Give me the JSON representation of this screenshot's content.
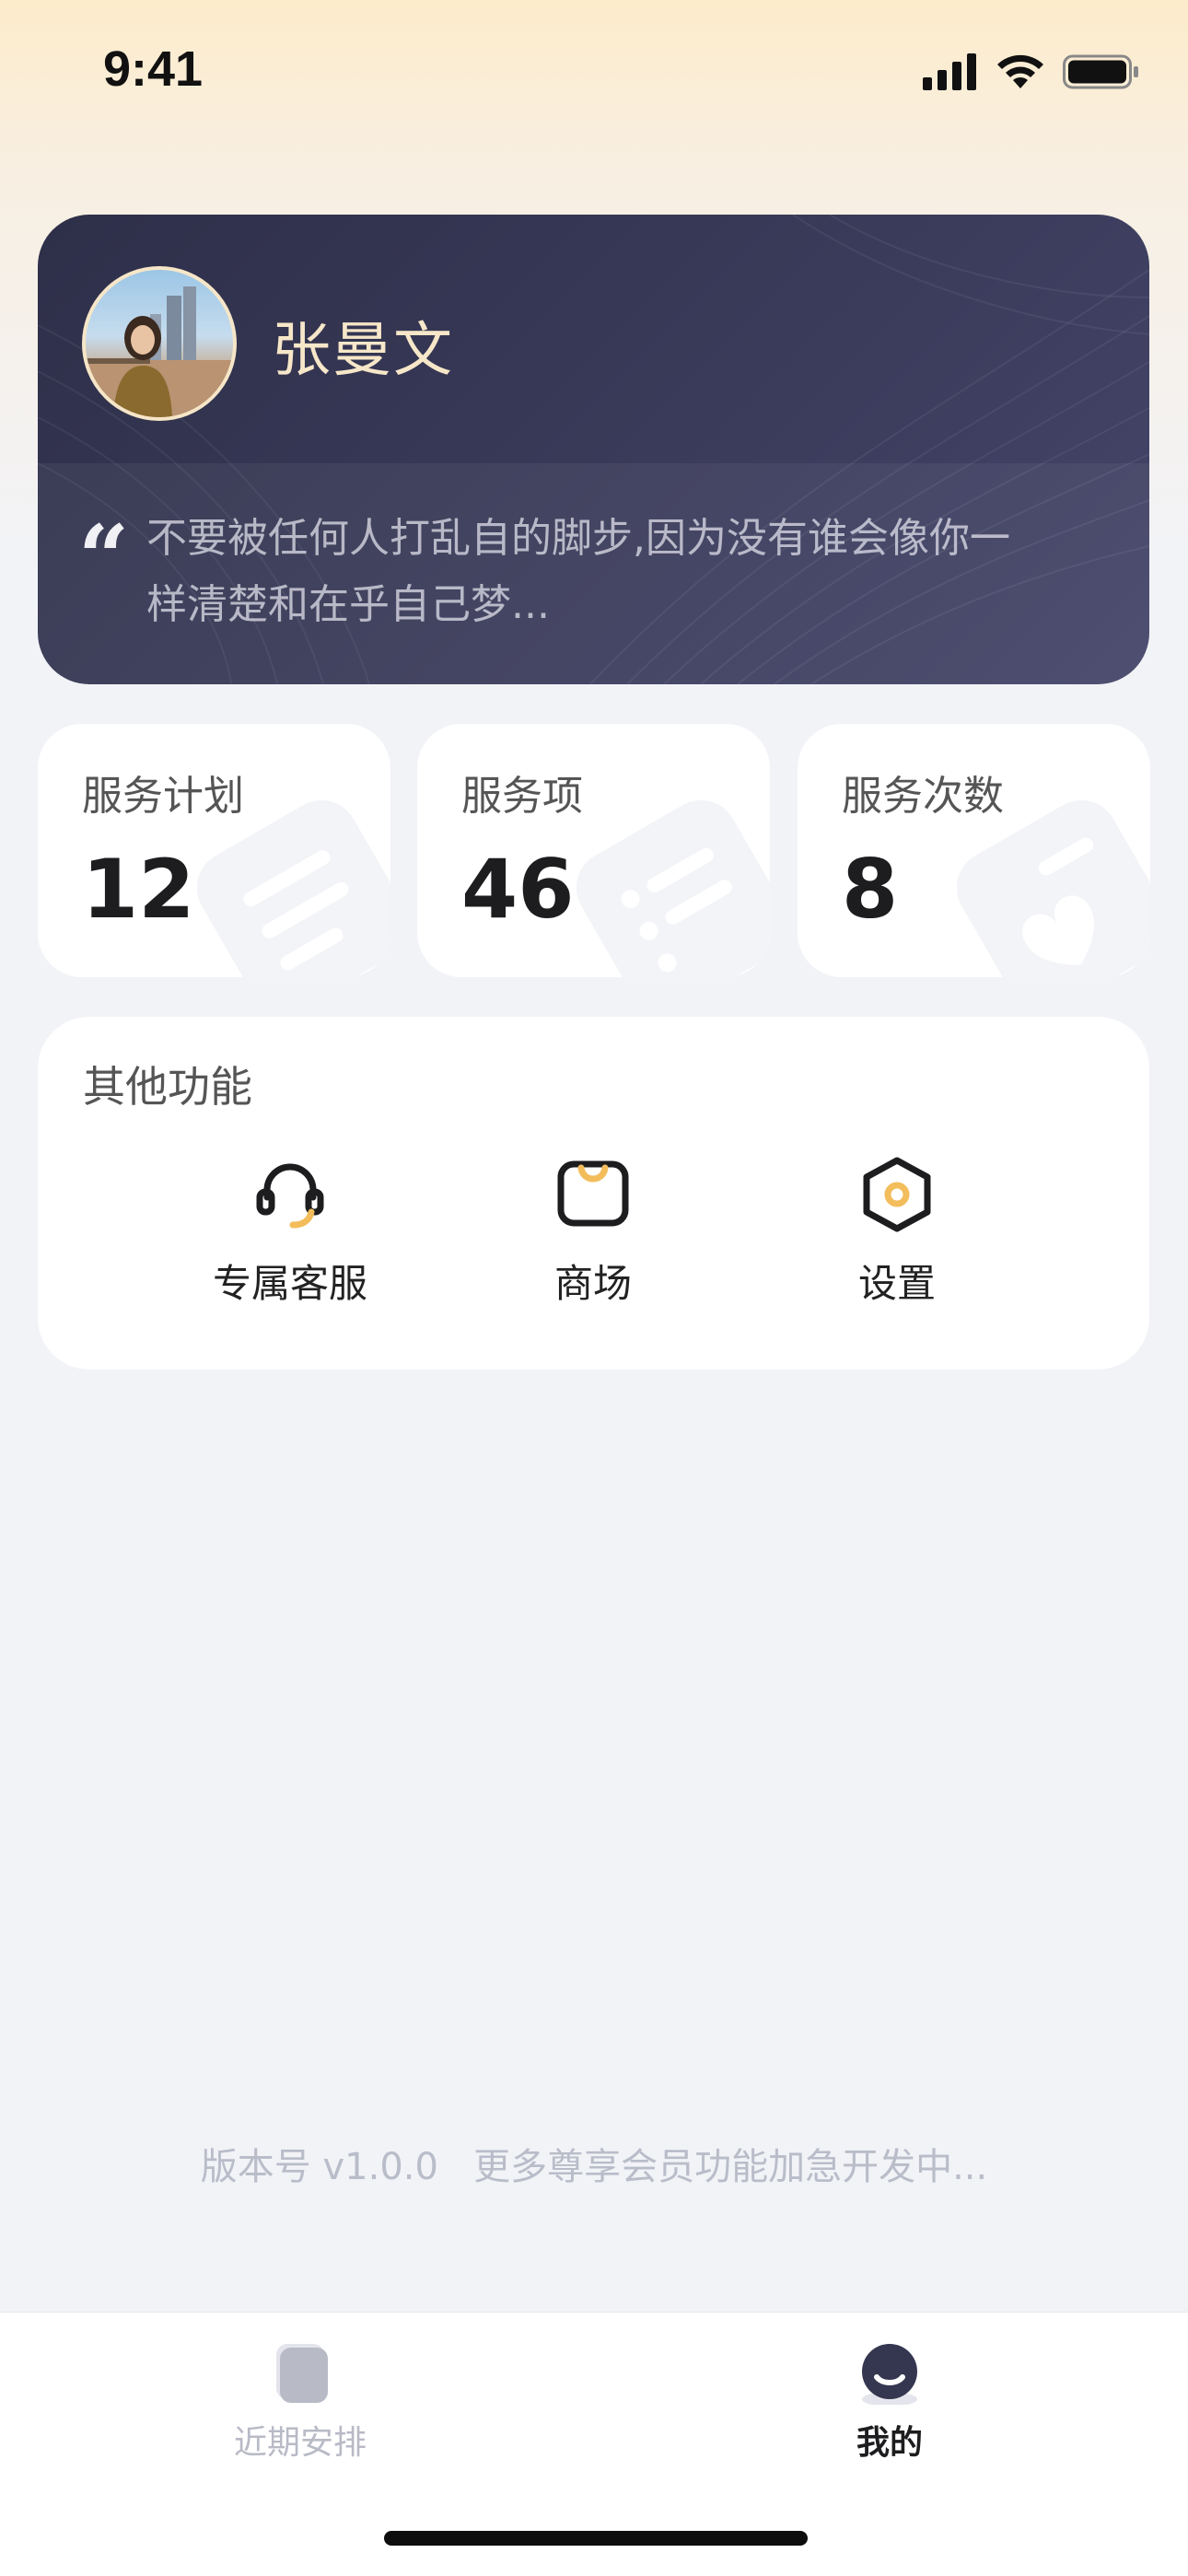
{
  "status_bar": {
    "time": "9:41",
    "icons": [
      "signal-icon",
      "wifi-icon",
      "battery-icon"
    ]
  },
  "profile": {
    "name": "张曼文",
    "motto_line1": "不要被任何人打乱自的脚步,因为没有谁会像你一",
    "motto_line2": "样清楚和在乎自己梦...",
    "quote_glyph": "“"
  },
  "stats": [
    {
      "label": "服务计划",
      "value": "12"
    },
    {
      "label": "服务项",
      "value": "46"
    },
    {
      "label": "服务次数",
      "value": "8"
    }
  ],
  "other_functions": {
    "title": "其他功能",
    "items": [
      {
        "label": "专属客服",
        "icon": "headset-icon"
      },
      {
        "label": "商场",
        "icon": "shopping-bag-icon"
      },
      {
        "label": "设置",
        "icon": "settings-hexagon-icon"
      }
    ]
  },
  "footer": {
    "version_text": "版本号 v1.0.0   更多尊享会员功能加急开发中..."
  },
  "tab_bar": {
    "tabs": [
      {
        "label": "近期安排",
        "icon": "calendar-icon",
        "active": false
      },
      {
        "label": "我的",
        "icon": "profile-icon",
        "active": true
      }
    ]
  },
  "colors": {
    "accent": "#f2bd5a",
    "card_dark": "#35364f",
    "name_gold": "#f7e7c9",
    "tab_inactive": "#b8bac6",
    "tab_active": "#1d1d1f"
  }
}
